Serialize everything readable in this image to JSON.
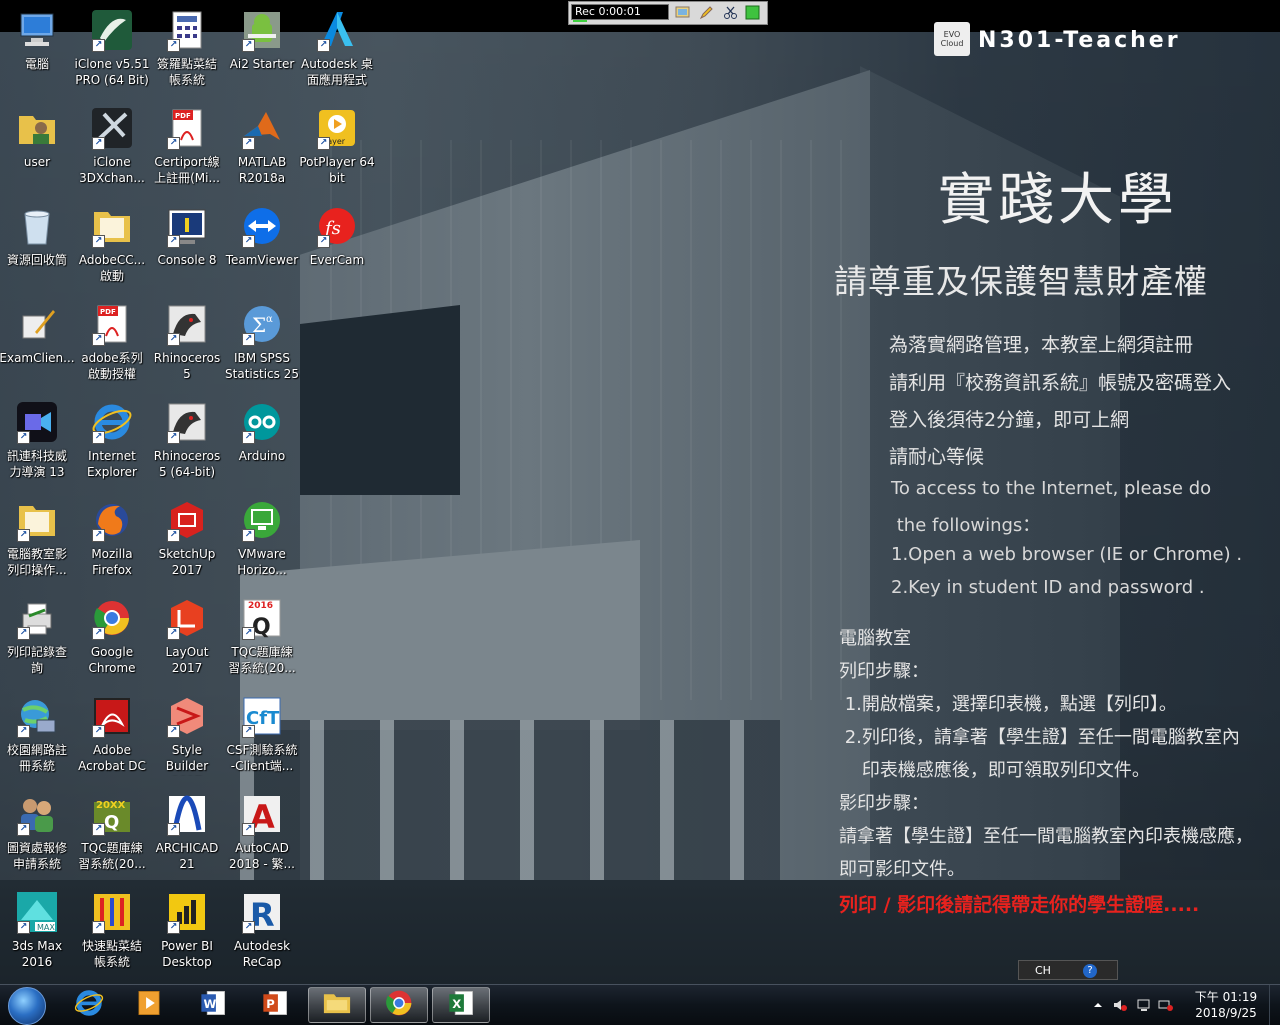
{
  "recorder": {
    "time": "Rec 0:00:01"
  },
  "branding": {
    "evo_logo": "EVO Cloud",
    "host": "N301-Teacher",
    "university": "實踐大學",
    "ip_title": "請尊重及保護智慧財產權"
  },
  "notice": {
    "zh_lines": [
      "為落實網路管理，本教室上網須註冊",
      "請利用『校務資訊系統』帳號及密碼登入",
      "登入後須待2分鐘，即可上網",
      "請耐心等候"
    ],
    "en_lines": [
      "To access to the Internet, please do",
      " the followings：",
      "1.Open a web browser (IE or Chrome) .",
      "2.Key in student ID and password ."
    ],
    "print_lines": [
      "電腦教室",
      "列印步驟：",
      " 1.開啟檔案，選擇印表機，點選【列印】。",
      " 2.列印後，請拿著【學生證】至任一間電腦教室內",
      "    印表機感應後，即可領取列印文件。",
      "影印步驟：",
      "請拿著【學生證】至任一間電腦教室內印表機感應，",
      "即可影印文件。"
    ],
    "warning": "列印 / 影印後請記得帶走你的學生證喔....."
  },
  "icons": [
    {
      "label": "電腦",
      "icon": "computer-icon"
    },
    {
      "label": "user",
      "icon": "user-folder-icon"
    },
    {
      "label": "資源回收筒",
      "icon": "recycle-bin-icon"
    },
    {
      "label": "ExamClien...",
      "icon": "exam-client-icon"
    },
    {
      "label": "訊連科技威\n力導演 13",
      "icon": "powerdirector-icon"
    },
    {
      "label": "電腦教室影\n列印操作...",
      "icon": "folder-icon"
    },
    {
      "label": "列印記錄查\n詢",
      "icon": "printer-icon"
    },
    {
      "label": "校園網路註\n冊系統",
      "icon": "network-icon"
    },
    {
      "label": "圖資處報修\n申請系統",
      "icon": "users-icon"
    },
    {
      "label": "3ds Max\n2016",
      "icon": "3dsmax-icon"
    },
    {
      "label": "iClone v5.51\nPRO (64 Bit)",
      "icon": "iclone-icon"
    },
    {
      "label": "iClone\n3DXchan...",
      "icon": "3dxchange-icon"
    },
    {
      "label": "AdobeCC...\n啟動",
      "icon": "folder-icon"
    },
    {
      "label": "adobe系列\n啟動授權",
      "icon": "pdf-icon"
    },
    {
      "label": "Internet\nExplorer",
      "icon": "ie-icon"
    },
    {
      "label": "Mozilla\nFirefox",
      "icon": "firefox-icon"
    },
    {
      "label": "Google\nChrome",
      "icon": "chrome-icon"
    },
    {
      "label": "Adobe\nAcrobat DC",
      "icon": "acrobat-icon"
    },
    {
      "label": "TQC題庫練\n習系統(20...",
      "icon": "tqc-icon"
    },
    {
      "label": "快速點菜結\n帳系統",
      "icon": "food-icon"
    },
    {
      "label": "簽羅點菜結\n帳系統",
      "icon": "calculator-icon"
    },
    {
      "label": "Certiport線\n上註冊(Mi...",
      "icon": "pdf-icon"
    },
    {
      "label": "Console 8",
      "icon": "console-icon"
    },
    {
      "label": "Rhinoceros\n5",
      "icon": "rhino-icon"
    },
    {
      "label": "Rhinoceros\n5 (64-bit)",
      "icon": "rhino-icon"
    },
    {
      "label": "SketchUp\n2017",
      "icon": "sketchup-icon"
    },
    {
      "label": "LayOut 2017",
      "icon": "layout-icon"
    },
    {
      "label": "Style Builder\n2017",
      "icon": "stylebuilder-icon"
    },
    {
      "label": "ARCHICAD\n21",
      "icon": "archicad-icon"
    },
    {
      "label": "Power BI\nDesktop",
      "icon": "powerbi-icon"
    },
    {
      "label": "Ai2 Starter",
      "icon": "android-icon"
    },
    {
      "label": "MATLAB\nR2018a",
      "icon": "matlab-icon"
    },
    {
      "label": "TeamViewer",
      "icon": "teamviewer-icon"
    },
    {
      "label": "IBM SPSS\nStatistics 25",
      "icon": "spss-icon"
    },
    {
      "label": "Arduino",
      "icon": "arduino-icon"
    },
    {
      "label": "VMware\nHorizo...",
      "icon": "vmware-icon"
    },
    {
      "label": "TQC題庫練\n習系統(20...",
      "icon": "tqc2016-icon"
    },
    {
      "label": "CSF測驗系統\n-Client端...",
      "icon": "csf-icon"
    },
    {
      "label": "AutoCAD\n2018 - 繁...",
      "icon": "autocad-icon"
    },
    {
      "label": "Autodesk\nReCap",
      "icon": "recap-icon"
    },
    {
      "label": "Autodesk 桌\n面應用程式",
      "icon": "autodesk-icon"
    },
    {
      "label": "PotPlayer 64\nbit",
      "icon": "potplayer-icon"
    },
    {
      "label": "EverCam",
      "icon": "evercam-icon"
    }
  ],
  "langbar": {
    "lang": "CH",
    "help": "?"
  },
  "taskbar": {
    "apps": [
      "ie-icon",
      "media-icon",
      "word-icon",
      "powerpoint-icon",
      "explorer-icon",
      "chrome-icon",
      "excel-icon"
    ],
    "clock_time": "下午 01:19",
    "clock_date": "2018/9/25"
  },
  "colors": {
    "warning": "#e8221e",
    "taskbar": "#0e141b"
  }
}
